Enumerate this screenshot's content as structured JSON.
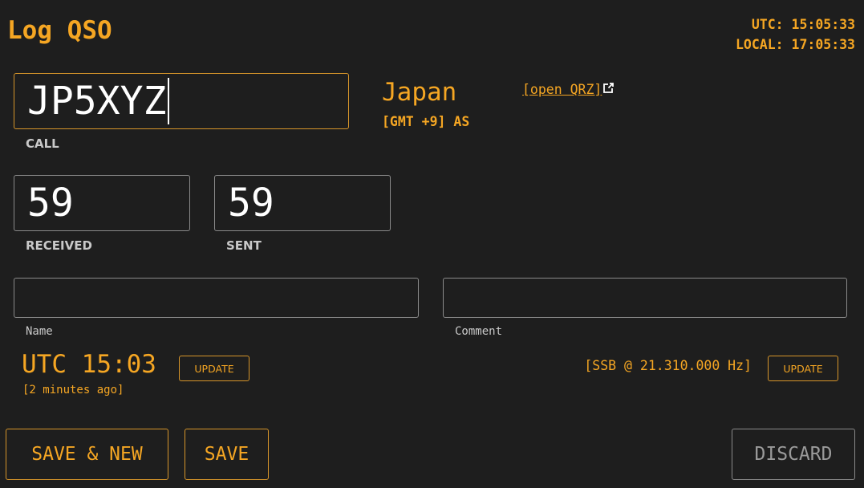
{
  "header": {
    "title": "Log QSO",
    "utc_clock": "UTC: 15:05:33",
    "local_clock": "LOCAL: 17:05:33"
  },
  "call": {
    "value": "JP5XYZ",
    "label": "CALL"
  },
  "station_info": {
    "country": "Japan",
    "timezone": "[GMT +9] AS",
    "qrz_link": "[open QRZ]"
  },
  "rst": {
    "received_value": "59",
    "received_label": "RECEIVED",
    "sent_value": "59",
    "sent_label": "SENT"
  },
  "name": {
    "value": "",
    "label": "Name"
  },
  "comment": {
    "value": "",
    "label": "Comment"
  },
  "time": {
    "display": "UTC 15:03",
    "ago": "[2 minutes ago]",
    "update_label": "UPDATE"
  },
  "frequency": {
    "display": "[SSB @ 21.310.000 Hz]",
    "update_label": "UPDATE"
  },
  "actions": {
    "save_new_label": "SAVE & NEW",
    "save_label": "SAVE",
    "discard_label": "DISCARD"
  },
  "colors": {
    "accent": "#f5a623",
    "background": "#1e1e1e",
    "field_border": "#8a8a8a",
    "label": "#c9c9c9"
  }
}
